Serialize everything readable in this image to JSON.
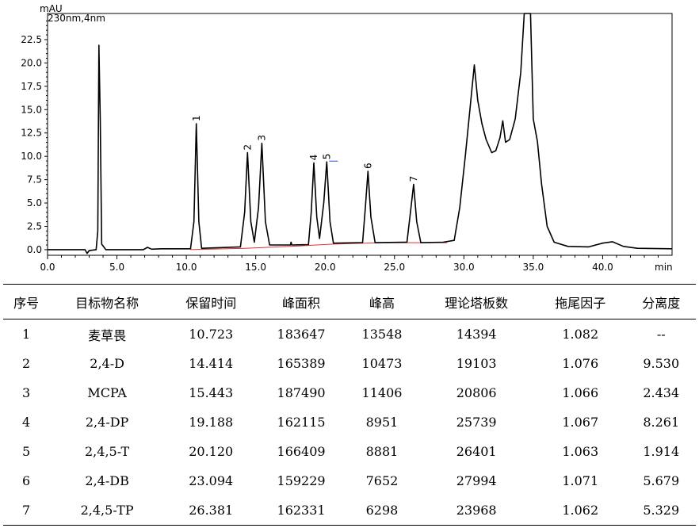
{
  "chart_data": {
    "type": "line",
    "ylabel": "mAU",
    "legend": "230nm,4nm",
    "xlabel": "min",
    "xlim": [
      0,
      45
    ],
    "ylim": [
      -0.6,
      25.3
    ],
    "x_ticks": [
      "0.0",
      "5.0",
      "10.0",
      "15.0",
      "20.0",
      "25.0",
      "30.0",
      "35.0",
      "40.0"
    ],
    "y_ticks": [
      "0.0",
      "2.5",
      "5.0",
      "7.5",
      "10.0",
      "12.5",
      "15.0",
      "17.5",
      "20.0",
      "22.5"
    ],
    "peaks": [
      {
        "label": "1",
        "x": 10.723,
        "y": 13.5
      },
      {
        "label": "2",
        "x": 14.414,
        "y": 10.4
      },
      {
        "label": "3",
        "x": 15.443,
        "y": 11.4
      },
      {
        "label": "4",
        "x": 19.188,
        "y": 9.3
      },
      {
        "label": "5",
        "x": 20.12,
        "y": 9.4
      },
      {
        "label": "6",
        "x": 23.094,
        "y": 8.4
      },
      {
        "label": "7",
        "x": 26.381,
        "y": 7.0
      }
    ],
    "trace": [
      [
        0.0,
        0.0
      ],
      [
        2.7,
        0.0
      ],
      [
        2.85,
        -0.4
      ],
      [
        3.0,
        -0.1
      ],
      [
        3.5,
        0.0
      ],
      [
        3.62,
        2.0
      ],
      [
        3.7,
        21.9
      ],
      [
        3.8,
        14.0
      ],
      [
        3.9,
        0.6
      ],
      [
        4.2,
        0.0
      ],
      [
        6.9,
        0.0
      ],
      [
        7.2,
        0.25
      ],
      [
        7.5,
        0.05
      ],
      [
        8.2,
        0.1
      ],
      [
        10.3,
        0.1
      ],
      [
        10.55,
        3.0
      ],
      [
        10.72,
        13.5
      ],
      [
        10.9,
        3.0
      ],
      [
        11.1,
        0.15
      ],
      [
        13.9,
        0.3
      ],
      [
        14.2,
        4.0
      ],
      [
        14.41,
        10.4
      ],
      [
        14.65,
        3.0
      ],
      [
        14.9,
        0.8
      ],
      [
        15.2,
        4.5
      ],
      [
        15.44,
        11.4
      ],
      [
        15.7,
        3.0
      ],
      [
        16.0,
        0.5
      ],
      [
        17.5,
        0.5
      ],
      [
        17.55,
        0.8
      ],
      [
        17.6,
        0.5
      ],
      [
        18.8,
        0.55
      ],
      [
        19.0,
        4.0
      ],
      [
        19.19,
        9.3
      ],
      [
        19.4,
        3.5
      ],
      [
        19.6,
        1.2
      ],
      [
        19.9,
        5.0
      ],
      [
        20.12,
        9.4
      ],
      [
        20.35,
        3.0
      ],
      [
        20.6,
        0.7
      ],
      [
        22.7,
        0.75
      ],
      [
        22.9,
        4.5
      ],
      [
        23.09,
        8.4
      ],
      [
        23.3,
        3.5
      ],
      [
        23.6,
        0.75
      ],
      [
        25.9,
        0.8
      ],
      [
        26.15,
        4.0
      ],
      [
        26.38,
        7.0
      ],
      [
        26.6,
        3.0
      ],
      [
        26.9,
        0.75
      ],
      [
        28.5,
        0.8
      ],
      [
        29.3,
        1.0
      ],
      [
        29.7,
        4.5
      ],
      [
        30.1,
        10.0
      ],
      [
        30.5,
        16.0
      ],
      [
        30.75,
        19.8
      ],
      [
        31.0,
        16.0
      ],
      [
        31.3,
        13.5
      ],
      [
        31.6,
        11.8
      ],
      [
        32.0,
        10.4
      ],
      [
        32.3,
        10.6
      ],
      [
        32.6,
        12.0
      ],
      [
        32.8,
        13.8
      ],
      [
        33.0,
        11.5
      ],
      [
        33.3,
        11.8
      ],
      [
        33.7,
        14.0
      ],
      [
        34.1,
        19.0
      ],
      [
        34.35,
        25.3
      ],
      [
        34.8,
        25.3
      ],
      [
        35.0,
        14.0
      ],
      [
        35.3,
        11.6
      ],
      [
        35.6,
        7.0
      ],
      [
        36.0,
        2.5
      ],
      [
        36.5,
        0.8
      ],
      [
        37.5,
        0.35
      ],
      [
        39.0,
        0.3
      ],
      [
        40.0,
        0.7
      ],
      [
        40.7,
        0.85
      ],
      [
        41.5,
        0.35
      ],
      [
        42.5,
        0.15
      ],
      [
        45.0,
        0.1
      ]
    ],
    "baseline": [
      [
        10.3,
        0.0
      ],
      [
        14.2,
        0.15
      ],
      [
        17.5,
        0.35
      ],
      [
        20.6,
        0.6
      ],
      [
        24.0,
        0.75
      ],
      [
        28.8,
        0.75
      ]
    ],
    "grid": false
  },
  "table": {
    "headers": [
      "序号",
      "目标物名称",
      "保留时间",
      "峰面积",
      "峰高",
      "理论塔板数",
      "拖尾因子",
      "分离度"
    ],
    "rows": [
      [
        "1",
        "麦草畏",
        "10.723",
        "183647",
        "13548",
        "14394",
        "1.082",
        "--"
      ],
      [
        "2",
        "2,4-D",
        "14.414",
        "165389",
        "10473",
        "19103",
        "1.076",
        "9.530"
      ],
      [
        "3",
        "MCPA",
        "15.443",
        "187490",
        "11406",
        "20806",
        "1.066",
        "2.434"
      ],
      [
        "4",
        "2,4-DP",
        "19.188",
        "162115",
        "8951",
        "25739",
        "1.067",
        "8.261"
      ],
      [
        "5",
        "2,4,5-T",
        "20.120",
        "166409",
        "8881",
        "26401",
        "1.063",
        "1.914"
      ],
      [
        "6",
        "2,4-DB",
        "23.094",
        "159229",
        "7652",
        "27994",
        "1.071",
        "5.679"
      ],
      [
        "7",
        "2,4,5-TP",
        "26.381",
        "162331",
        "6298",
        "23968",
        "1.062",
        "5.329"
      ]
    ]
  }
}
